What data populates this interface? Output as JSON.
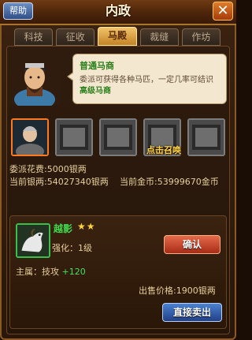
{
  "header": {
    "help_label": "帮助",
    "title": "内政",
    "close_glyph": "✕"
  },
  "tabs": [
    {
      "label": "科技",
      "active": false
    },
    {
      "label": "征收",
      "active": false
    },
    {
      "label": "马殿",
      "active": true
    },
    {
      "label": "裁缝",
      "active": false
    },
    {
      "label": "作坊",
      "active": false
    }
  ],
  "merchant": {
    "name": "普通马商",
    "desc_prefix": "委派可获得各种马匹，一定几率可结识",
    "desc_highlight": "高级马商"
  },
  "slots": {
    "summon_label": "点击召唤"
  },
  "stats": {
    "dispatch_cost_label": "委派花费:",
    "dispatch_cost_value": "5000银两",
    "current_silver_label": "当前银两:",
    "current_silver_value": "54027340银两",
    "current_gold_label": "当前金币:",
    "current_gold_value": "53999670金币"
  },
  "item": {
    "name": "越影",
    "stars": "★★",
    "enhance": "强化：1级",
    "main_attr_label": "主属：技攻",
    "main_attr_bonus": " +120",
    "price_label": "出售价格:",
    "price_value": "1900银两"
  },
  "buttons": {
    "confirm": "确认",
    "sell": "直接卖出"
  },
  "colors": {
    "accent_green": "#3fd84c",
    "tab_active": "#f1c46a",
    "button_red": "#a82c16",
    "button_blue": "#213f86"
  }
}
